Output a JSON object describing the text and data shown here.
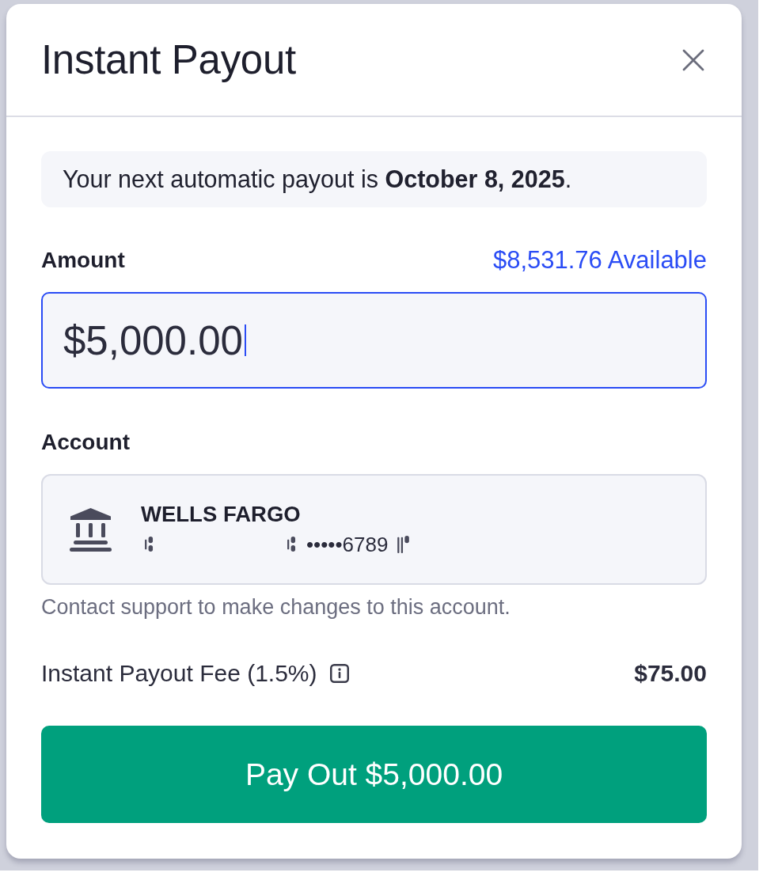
{
  "dialog": {
    "title": "Instant Payout"
  },
  "notice": {
    "text": "Your next automatic payout is **October 8, 2025**."
  },
  "amount": {
    "label": "Amount",
    "available": "$8,531.76 Available",
    "value": "$5,000.00",
    "focused": true
  },
  "account": {
    "label": "Account",
    "bank_name": "WELLS FARGO",
    "masked_number": "•••••6789",
    "note": "Contact support to make changes to this account."
  },
  "fee": {
    "label": "Instant Payout Fee (1.5%)",
    "amount": "$75.00"
  },
  "submit": {
    "label": "Pay Out $5,000.00"
  }
}
